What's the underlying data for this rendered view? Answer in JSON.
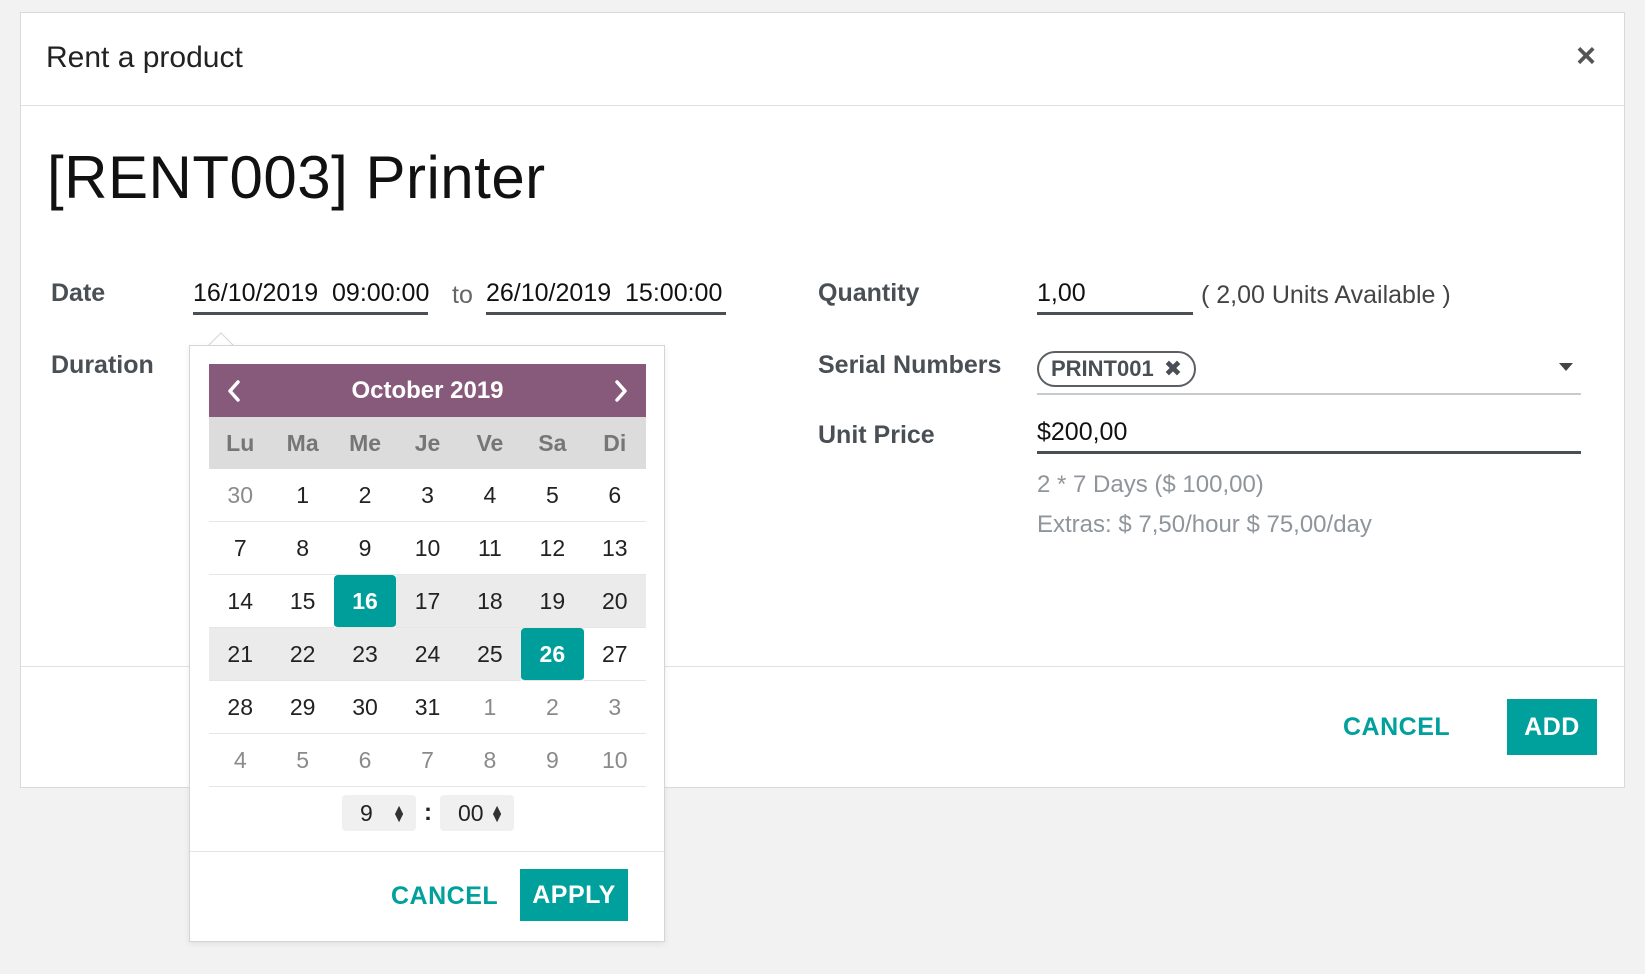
{
  "dialog": {
    "title": "Rent a product",
    "close_glyph": "×",
    "product_title": "[RENT003] Printer"
  },
  "fields": {
    "date_label": "Date",
    "start_date": "16/10/2019",
    "start_time": "09:00:00",
    "to_label": "to",
    "end_date": "26/10/2019",
    "end_time": "15:00:00",
    "duration_label": "Duration",
    "quantity_label": "Quantity",
    "quantity_value": "1,00",
    "units_available": "( 2,00 Units Available )",
    "serial_label": "Serial Numbers",
    "serial_tag": "PRINT001",
    "unit_price_label": "Unit Price",
    "unit_price_value": "$200,00",
    "price_note": "2 * 7 Days ($ 100,00)",
    "extras_note": "Extras: $ 7,50/hour $ 75,00/day"
  },
  "footer": {
    "cancel_label": "CANCEL",
    "add_label": "ADD"
  },
  "datepicker": {
    "month_label": "October 2019",
    "weekdays": [
      "Lu",
      "Ma",
      "Me",
      "Je",
      "Ve",
      "Sa",
      "Di"
    ],
    "days": [
      {
        "label": "30",
        "state": "off"
      },
      {
        "label": "1",
        "state": ""
      },
      {
        "label": "2",
        "state": ""
      },
      {
        "label": "3",
        "state": ""
      },
      {
        "label": "4",
        "state": ""
      },
      {
        "label": "5",
        "state": ""
      },
      {
        "label": "6",
        "state": ""
      },
      {
        "label": "7",
        "state": ""
      },
      {
        "label": "8",
        "state": ""
      },
      {
        "label": "9",
        "state": ""
      },
      {
        "label": "10",
        "state": ""
      },
      {
        "label": "11",
        "state": ""
      },
      {
        "label": "12",
        "state": ""
      },
      {
        "label": "13",
        "state": ""
      },
      {
        "label": "14",
        "state": ""
      },
      {
        "label": "15",
        "state": ""
      },
      {
        "label": "16",
        "state": "selected"
      },
      {
        "label": "17",
        "state": "range"
      },
      {
        "label": "18",
        "state": "range"
      },
      {
        "label": "19",
        "state": "range"
      },
      {
        "label": "20",
        "state": "range"
      },
      {
        "label": "21",
        "state": "range"
      },
      {
        "label": "22",
        "state": "range"
      },
      {
        "label": "23",
        "state": "range"
      },
      {
        "label": "24",
        "state": "range"
      },
      {
        "label": "25",
        "state": "range"
      },
      {
        "label": "26",
        "state": "selected"
      },
      {
        "label": "27",
        "state": ""
      },
      {
        "label": "28",
        "state": ""
      },
      {
        "label": "29",
        "state": ""
      },
      {
        "label": "30",
        "state": ""
      },
      {
        "label": "31",
        "state": ""
      },
      {
        "label": "1",
        "state": "off"
      },
      {
        "label": "2",
        "state": "off"
      },
      {
        "label": "3",
        "state": "off"
      },
      {
        "label": "4",
        "state": "off"
      },
      {
        "label": "5",
        "state": "off"
      },
      {
        "label": "6",
        "state": "off"
      },
      {
        "label": "7",
        "state": "off"
      },
      {
        "label": "8",
        "state": "off"
      },
      {
        "label": "9",
        "state": "off"
      },
      {
        "label": "10",
        "state": "off"
      }
    ],
    "hour": "9",
    "minute": "00",
    "colon": ":",
    "cancel_label": "CANCEL",
    "apply_label": "APPLY"
  },
  "colors": {
    "accent": "#00a09d",
    "calendar_header": "#875a7b"
  }
}
